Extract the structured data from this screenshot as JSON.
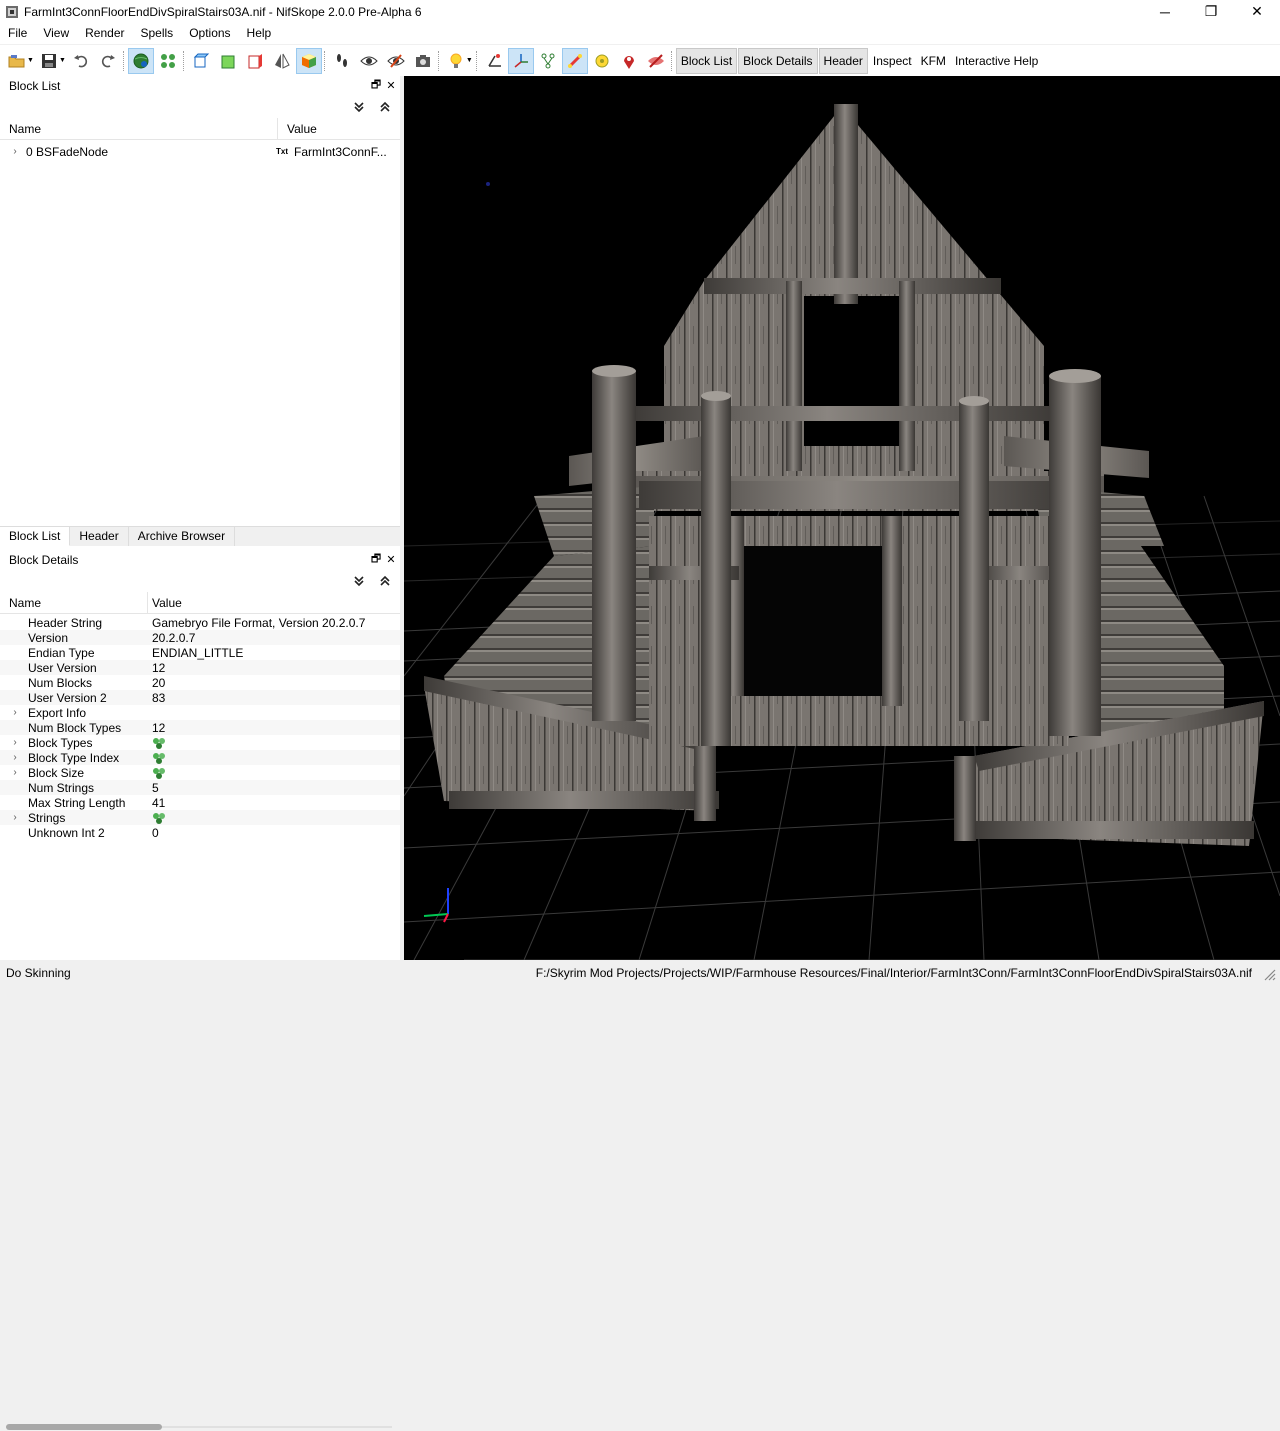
{
  "window": {
    "title": "FarmInt3ConnFloorEndDivSpiralStairs03A.nif - NifSkope 2.0.0 Pre-Alpha 6",
    "minimize": "─",
    "maximize": "❐",
    "close": "✕"
  },
  "menu": [
    "File",
    "View",
    "Render",
    "Spells",
    "Options",
    "Help"
  ],
  "toolbar": {
    "text_buttons": [
      "Block List",
      "Block Details",
      "Header",
      "Inspect",
      "KFM",
      "Interactive Help"
    ],
    "active_text_buttons": [
      "Block List",
      "Block Details",
      "Header"
    ]
  },
  "block_list": {
    "title": "Block List",
    "columns": [
      "Name",
      "Value"
    ],
    "rows": [
      {
        "name": "0 BSFadeNode",
        "badge": "Txt",
        "value": "FarmInt3ConnF..."
      }
    ]
  },
  "tabs": [
    "Block List",
    "Header",
    "Archive Browser"
  ],
  "active_tab": "Block List",
  "block_details": {
    "title": "Block Details",
    "columns": [
      "Name",
      "Value"
    ],
    "rows": [
      {
        "name": "Header String",
        "value": "Gamebryo File Format, Version 20.2.0.7",
        "expandable": false,
        "icon": false
      },
      {
        "name": "Version",
        "value": "20.2.0.7",
        "expandable": false,
        "icon": false
      },
      {
        "name": "Endian Type",
        "value": "ENDIAN_LITTLE",
        "expandable": false,
        "icon": false
      },
      {
        "name": "User Version",
        "value": "12",
        "expandable": false,
        "icon": false
      },
      {
        "name": "Num Blocks",
        "value": "20",
        "expandable": false,
        "icon": false
      },
      {
        "name": "User Version 2",
        "value": "83",
        "expandable": false,
        "icon": false
      },
      {
        "name": "Export Info",
        "value": "",
        "expandable": true,
        "icon": false
      },
      {
        "name": "Num Block Types",
        "value": "12",
        "expandable": false,
        "icon": false
      },
      {
        "name": "Block Types",
        "value": "",
        "expandable": true,
        "icon": true
      },
      {
        "name": "Block Type Index",
        "value": "",
        "expandable": true,
        "icon": true
      },
      {
        "name": "Block Size",
        "value": "",
        "expandable": true,
        "icon": true
      },
      {
        "name": "Num Strings",
        "value": "5",
        "expandable": false,
        "icon": false
      },
      {
        "name": "Max String Length",
        "value": "41",
        "expandable": false,
        "icon": false
      },
      {
        "name": "Strings",
        "value": "",
        "expandable": true,
        "icon": true
      },
      {
        "name": "Unknown Int 2",
        "value": "0",
        "expandable": false,
        "icon": false
      }
    ]
  },
  "status": {
    "left": "Do Skinning",
    "right": "F:/Skyrim Mod Projects/Projects/WIP/Farmhouse Resources/Final/Interior/FarmInt3Conn/FarmInt3ConnFloorEndDivSpiralStairs03A.nif"
  },
  "colors": {
    "viewport_bg": "#000000",
    "grid": "#3a3a3a",
    "wood_light": "#8a8580",
    "wood_dark": "#4a4642",
    "active_tool": "#cce4f7"
  }
}
